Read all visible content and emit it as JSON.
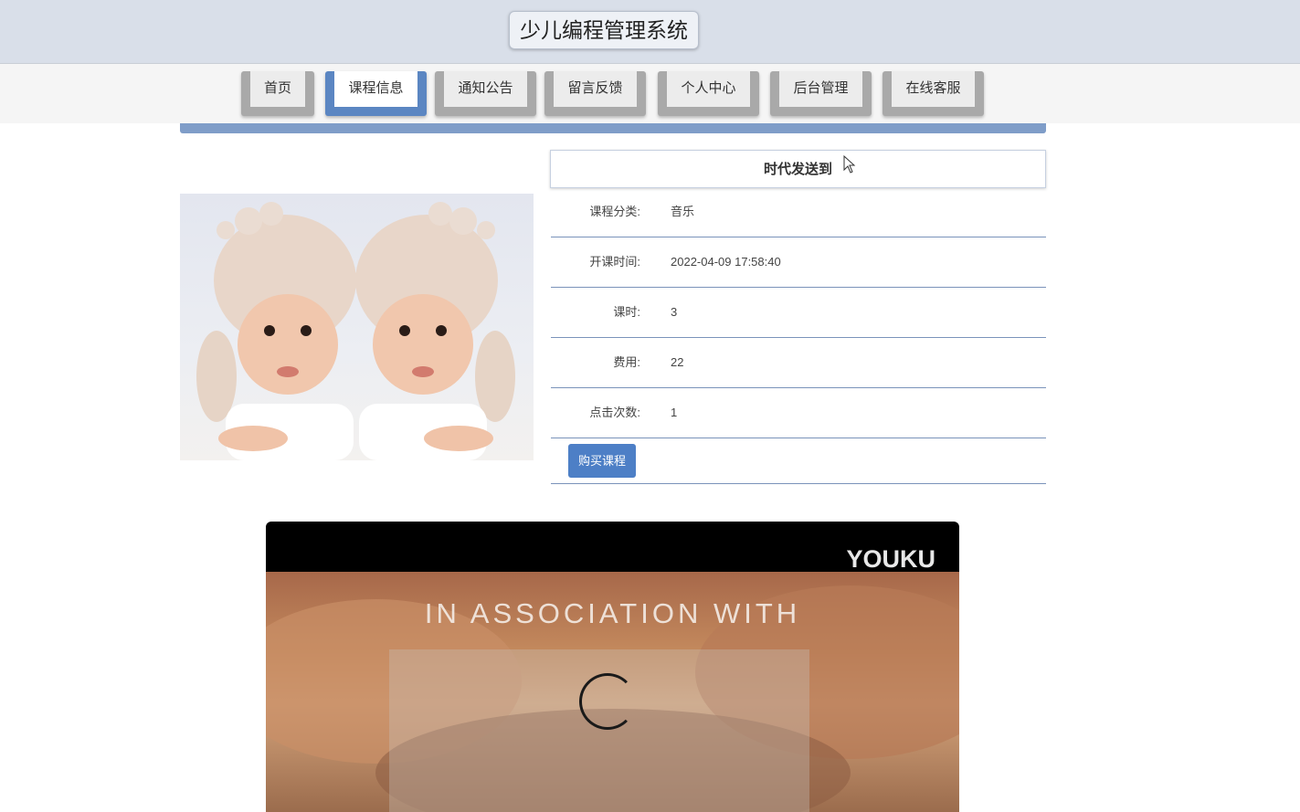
{
  "header": {
    "site_title": "少儿编程管理系统"
  },
  "nav": {
    "items": [
      {
        "label": "首页"
      },
      {
        "label": "课程信息",
        "active": true
      },
      {
        "label": "通知公告"
      },
      {
        "label": "留言反馈"
      },
      {
        "label": "个人中心"
      },
      {
        "label": "后台管理"
      },
      {
        "label": "在线客服"
      }
    ]
  },
  "course": {
    "title": "时代发送到",
    "image_icon": "course-photo-babies",
    "fields": [
      {
        "label": "课程分类:",
        "value": "音乐"
      },
      {
        "label": "开课时间:",
        "value": "2022-04-09 17:58:40"
      },
      {
        "label": "课时:",
        "value": "3"
      },
      {
        "label": "费用:",
        "value": "22"
      },
      {
        "label": "点击次数:",
        "value": "1"
      }
    ],
    "buy_label": "购买课程"
  },
  "video": {
    "logo_text": "YOUKU",
    "caption": "IN ASSOCIATION WITH",
    "spinner_icon": "loading-spinner-icon"
  },
  "colors": {
    "topbar_bg": "#d9dfe9",
    "accent_blue": "#5b86c2",
    "button_blue": "#4d7fc6",
    "row_divider": "#7a93ba"
  }
}
